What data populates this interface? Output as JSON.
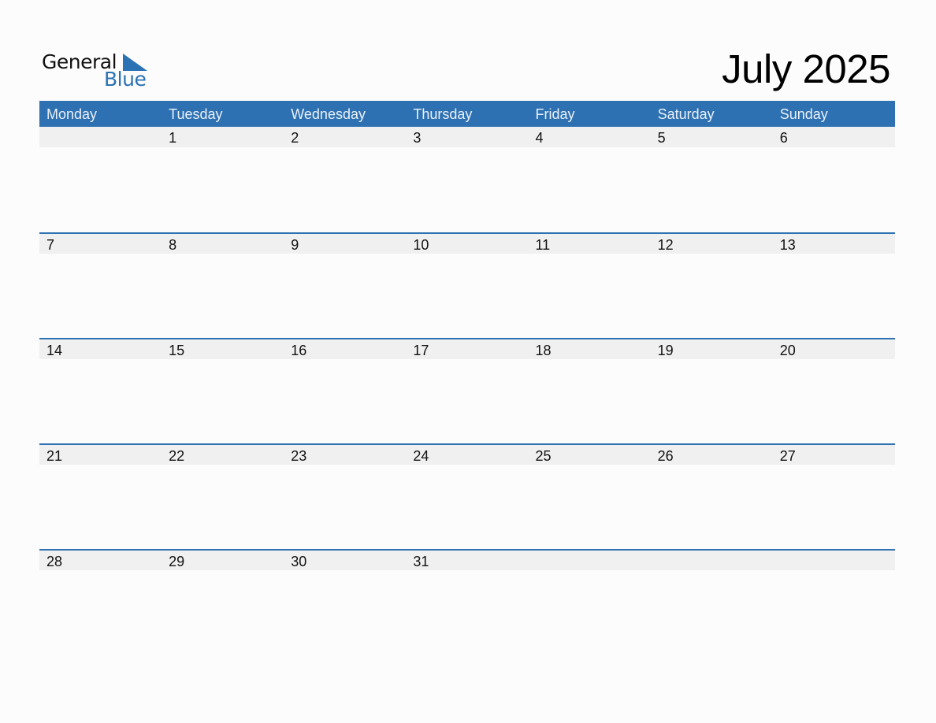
{
  "logo": {
    "line1": "General",
    "line2": "Blue"
  },
  "title": "July 2025",
  "colors": {
    "accent": "#2e71b2",
    "date_bar": "#f0f0f0"
  },
  "weekdays": [
    "Monday",
    "Tuesday",
    "Wednesday",
    "Thursday",
    "Friday",
    "Saturday",
    "Sunday"
  ],
  "weeks": [
    [
      "",
      "1",
      "2",
      "3",
      "4",
      "5",
      "6"
    ],
    [
      "7",
      "8",
      "9",
      "10",
      "11",
      "12",
      "13"
    ],
    [
      "14",
      "15",
      "16",
      "17",
      "18",
      "19",
      "20"
    ],
    [
      "21",
      "22",
      "23",
      "24",
      "25",
      "26",
      "27"
    ],
    [
      "28",
      "29",
      "30",
      "31",
      "",
      "",
      ""
    ]
  ]
}
